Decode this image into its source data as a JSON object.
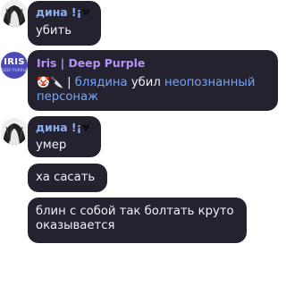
{
  "messages": [
    {
      "sender": "дина !¡",
      "sender_mark": "♥",
      "text": "убить"
    },
    {
      "sender": "Iris | Deep Purple",
      "avatar_text": "IRIS",
      "avatar_sub": "DEEP PURPLE",
      "emojis": "🤡🔪",
      "separator": "|",
      "link1": "блядина",
      "action": " убил ",
      "link2_line1": "неопознанный",
      "link2_line2": "персонаж"
    },
    {
      "sender": "дина !¡",
      "sender_mark": "♥",
      "text": "умер"
    },
    {
      "text": "ха сасать"
    },
    {
      "line1": "блин с собой так болтать круто",
      "line2": "оказывается"
    }
  ]
}
